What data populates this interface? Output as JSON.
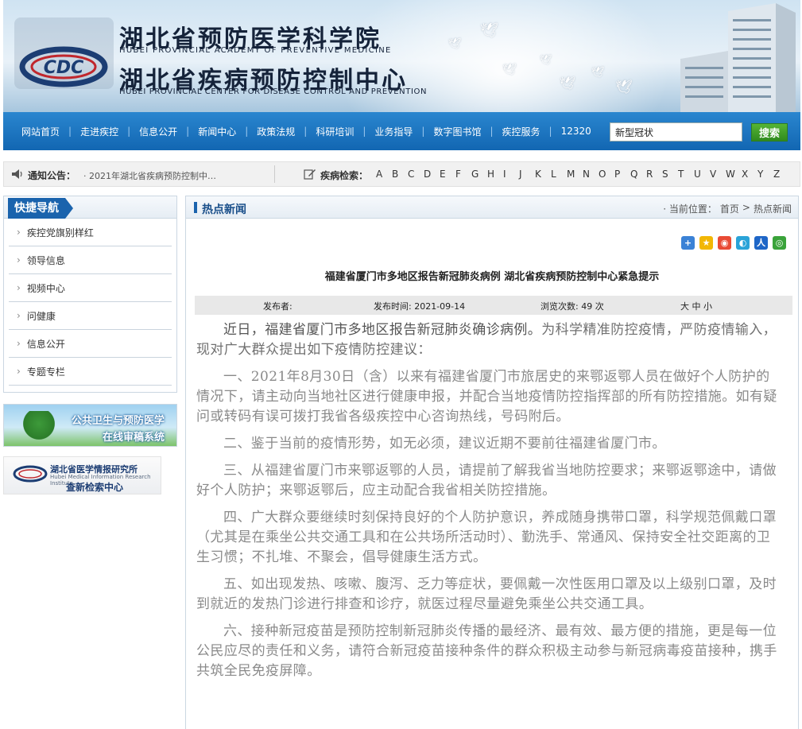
{
  "header": {
    "title_1": "湖北省预防医学科学院",
    "sub_1": "HUBEI PROVINCIAL ACADEMY OF PREVENTIVE MEDICINE",
    "title_2": "湖北省疾病预防控制中心",
    "sub_2": "HUBEI PROVINCIAL CENTER FOR DISEASE CONTROL AND PREVENTION",
    "logo_text": "CDC"
  },
  "nav": {
    "items": [
      "网站首页",
      "走进疾控",
      "信息公开",
      "新闻中心",
      "政策法规",
      "科研培训",
      "业务指导",
      "数字图书馆",
      "疾控服务",
      "12320"
    ],
    "search_value": "新型冠状",
    "search_button": "搜索"
  },
  "notice": {
    "label": "通知公告：",
    "text": "· 2021年湖北省疾病预防控制中…",
    "disease_label": "疾病检索：",
    "letters": [
      "A",
      "B",
      "C",
      "D",
      "E",
      "F",
      "G",
      "H",
      "I",
      "J",
      "K",
      "L",
      "M",
      "N",
      "O",
      "P",
      "Q",
      "R",
      "S",
      "T",
      "U",
      "V",
      "W",
      "X",
      "Y",
      "Z"
    ]
  },
  "sidebar": {
    "title": "快捷导航",
    "items": [
      "疾控党旗别样红",
      "领导信息",
      "视频中心",
      "问健康",
      "信息公开",
      "专题专栏"
    ],
    "ad1_line1": "公共卫生与预防医学",
    "ad1_line2": "在线审稿系统",
    "ad2_line1": "湖北省医学情报研究所",
    "ad2_line2": "Hubei Medical Information Research Institute",
    "ad2_line3": "查新检索中心"
  },
  "main": {
    "section_title": "热点新闻",
    "breadcrumb_prefix": "· 当前位置：",
    "breadcrumb_home": "首页",
    "breadcrumb_sep": ">",
    "breadcrumb_current": "热点新闻",
    "article_title": "福建省厦门市多地区报告新冠肺炎病例 湖北省疾病预防控制中心紧急提示",
    "meta": {
      "publisher": "发布者:",
      "time": "发布时间: 2021-09-14",
      "views": "浏览次数: 49 次",
      "size": "大 中 小"
    },
    "lead_strong": "近日，福建省厦门市多地区报告新冠肺炎确诊病例。",
    "lead_rest": "为科学精准防控疫情，严防疫情输入，现对广大群众提出如下疫情防控建议：",
    "paragraphs": [
      "一、2021年8月30日（含）以来有福建省厦门市旅居史的来鄂返鄂人员在做好个人防护的情况下，请主动向当地社区进行健康申报，并配合当地疫情防控指挥部的所有防控措施。如有疑问或转码有误可拨打我省各级疾控中心咨询热线，号码附后。",
      "二、鉴于当前的疫情形势，如无必须，建议近期不要前往福建省厦门市。",
      "三、从福建省厦门市来鄂返鄂的人员，请提前了解我省当地防控要求；来鄂返鄂途中，请做好个人防护；来鄂返鄂后，应主动配合我省相关防控措施。",
      "四、广大群众要继续时刻保持良好的个人防护意识，养成随身携带口罩，科学规范佩戴口罩（尤其是在乘坐公共交通工具和在公共场所活动时）、勤洗手、常通风、保持安全社交距离的卫生习惯；不扎堆、不聚会，倡导健康生活方式。",
      "五、如出现发热、咳嗽、腹泻、乏力等症状，要佩戴一次性医用口罩及以上级别口罩，及时到就近的发热门诊进行排查和诊疗，就医过程尽量避免乘坐公共交通工具。",
      "六、接种新冠疫苗是预防控制新冠肺炎传播的最经济、最有效、最方便的措施，更是每一位公民应尽的责任和义务，请符合新冠疫苗接种条件的群众积极主动参与新冠病毒疫苗接种，携手共筑全民免疫屏障。"
    ]
  },
  "colors": {
    "nav_blue": "#1266b2",
    "accent_blue": "#1a63ad",
    "search_green": "#2f8a1e"
  }
}
